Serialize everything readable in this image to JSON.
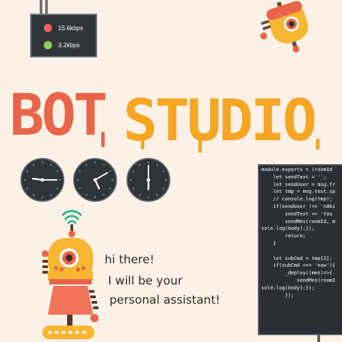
{
  "status": {
    "upload_rate": "15.6kbps",
    "download_rate": "3.2kbps",
    "upload_color": "#f0605d",
    "download_color": "#8fcf5c"
  },
  "logo": {
    "text": "BOTSTUDIO",
    "bot_color": "#e8654a",
    "studio_color": "#f5a623"
  },
  "clocks": [
    {
      "hour": 9,
      "minute": 15
    },
    {
      "hour": 5,
      "minute": 10
    },
    {
      "hour": 6,
      "minute": 0
    }
  ],
  "code_lines": [
    "module.exports = (roomId",
    "    let sendText = '';",
    "    let sendUser = msg.fr",
    "    let tmp = msg.text.sp",
    "    // console.log(tmp);",
    "    if(sendUser !== 'n0bi",
    "        sendText += 'You",
    "        sendMes(roomId, m",
    "sole.log(body);});",
    "        return;",
    "    }",
    "",
    "    let subCmd = tmp[2];",
    "    if(subCmd === 'now'){",
    "        _deploy((mes)=>{",
    "            sendMes(roomI",
    "sole.log(body);});",
    "        });"
  ],
  "speech": {
    "line1": "hi there!",
    "line2": "I will be your",
    "line3": "personal assistant!"
  }
}
